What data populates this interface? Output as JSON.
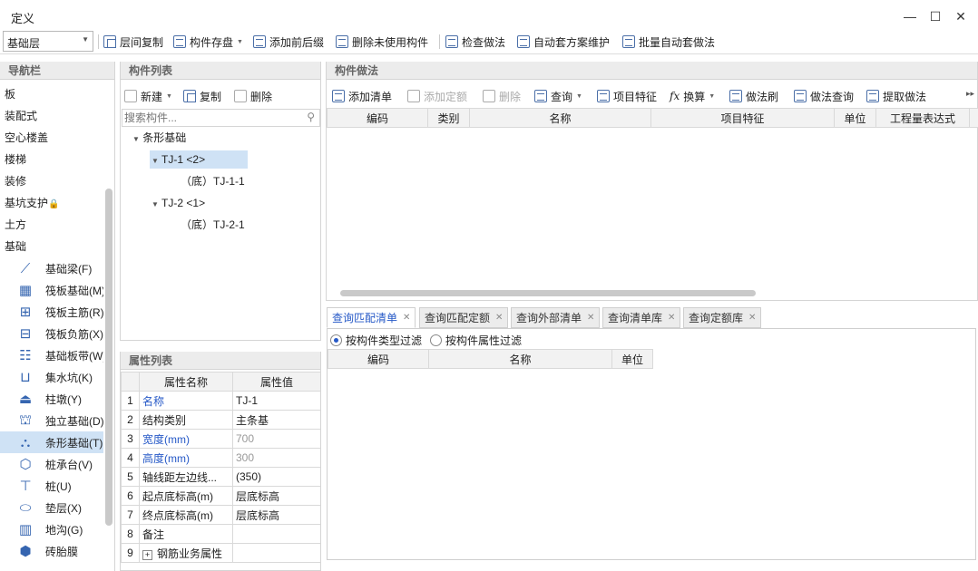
{
  "window": {
    "title": "定义",
    "minimize": "—",
    "maximize": "☐",
    "close": "✕"
  },
  "toolbar": {
    "floor": "基础层",
    "items": [
      "层间复制",
      "构件存盘",
      "添加前后缀",
      "删除未使用构件",
      "检查做法",
      "自动套方案维护",
      "批量自动套做法"
    ]
  },
  "nav": {
    "header": "导航栏",
    "items": [
      "板",
      "装配式",
      "空心楼盖",
      "楼梯",
      "装修",
      "基坑支护",
      "土方",
      "基础"
    ],
    "sub_items": [
      "基础梁(F)",
      "筏板基础(M)",
      "筏板主筋(R)",
      "筏板负筋(X)",
      "基础板带(W)",
      "集水坑(K)",
      "柱墩(Y)",
      "独立基础(D)",
      "条形基础(T)",
      "桩承台(V)",
      "桩(U)",
      "垫层(X)",
      "地沟(G)",
      "砖胎膜"
    ]
  },
  "component_list": {
    "header": "构件列表",
    "new": "新建",
    "copy": "复制",
    "delete": "删除",
    "search_placeholder": "搜索构件...",
    "tree": {
      "root": "条形基础",
      "n1": "TJ-1 <2>",
      "n1c": "（底）TJ-1-1",
      "n2": "TJ-2 <1>",
      "n2c": "（底）TJ-2-1"
    }
  },
  "properties": {
    "header": "属性列表",
    "col_name": "属性名称",
    "col_value": "属性值",
    "rows": [
      {
        "no": "1",
        "name": "名称",
        "value": "TJ-1"
      },
      {
        "no": "2",
        "name": "结构类别",
        "value": "主条基"
      },
      {
        "no": "3",
        "name": "宽度(mm)",
        "value": "700"
      },
      {
        "no": "4",
        "name": "高度(mm)",
        "value": "300"
      },
      {
        "no": "5",
        "name": "轴线距左边线...",
        "value": "(350)"
      },
      {
        "no": "6",
        "name": "起点底标高(m)",
        "value": "层底标高"
      },
      {
        "no": "7",
        "name": "终点底标高(m)",
        "value": "层底标高"
      },
      {
        "no": "8",
        "name": "备注",
        "value": ""
      },
      {
        "no": "9",
        "name": "钢筋业务属性",
        "value": ""
      }
    ]
  },
  "method": {
    "header": "构件做法",
    "tools": [
      "添加清单",
      "添加定额",
      "删除",
      "查询",
      "项目特征",
      "换算",
      "做法刷",
      "做法查询",
      "提取做法"
    ],
    "cols": [
      "编码",
      "类别",
      "名称",
      "项目特征",
      "单位",
      "工程量表达式"
    ]
  },
  "query": {
    "tabs": [
      "查询匹配清单",
      "查询匹配定额",
      "查询外部清单",
      "查询清单库",
      "查询定额库"
    ],
    "filter_type": "按构件类型过滤",
    "filter_attr": "按构件属性过滤",
    "cols": [
      "编码",
      "名称",
      "单位"
    ]
  }
}
